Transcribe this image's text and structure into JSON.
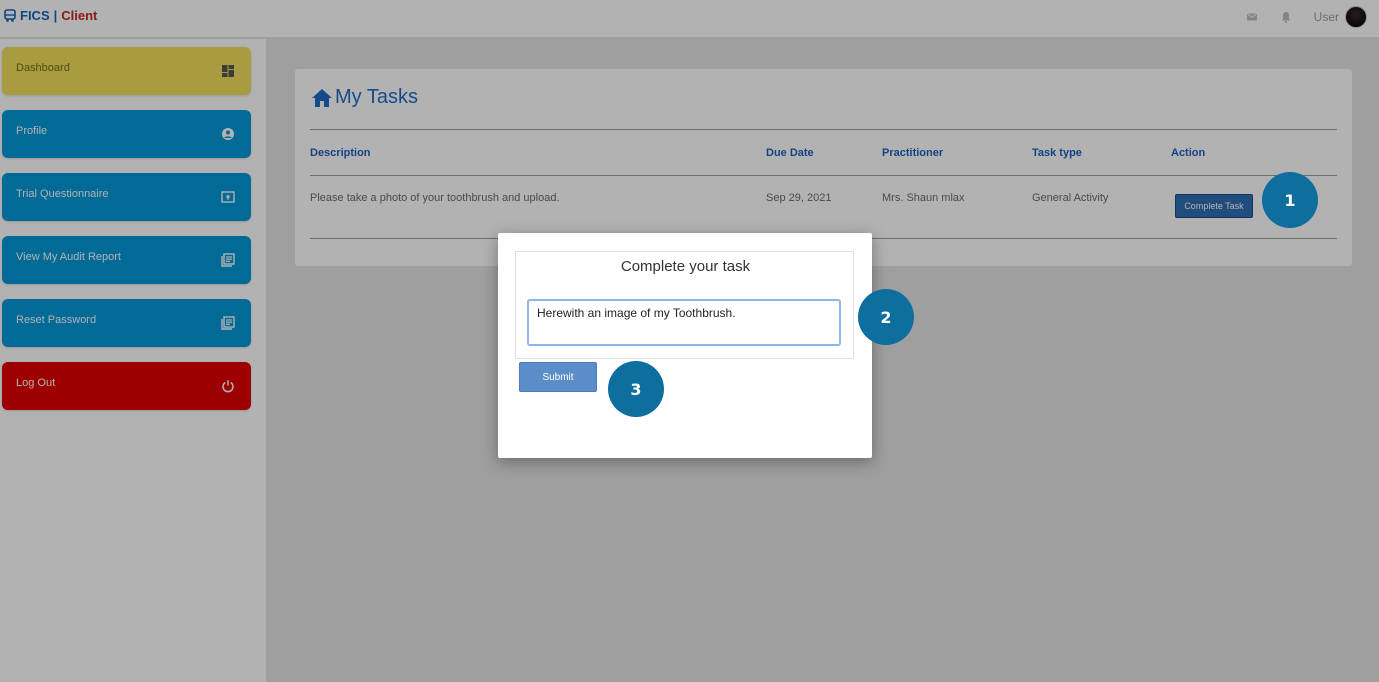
{
  "header": {
    "brand_primary": "FICS",
    "brand_separator": "|",
    "brand_secondary": "Client",
    "user_label": "User",
    "icons": [
      "bus-icon",
      "mail-icon",
      "bell-icon",
      "avatar"
    ]
  },
  "sidebar": {
    "items": [
      {
        "label": "Dashboard",
        "icon": "dashboard-icon",
        "color": "#f1df5c"
      },
      {
        "label": "Profile",
        "icon": "user-circle-icon",
        "color": "#0299d8"
      },
      {
        "label": "Trial Questionnaire",
        "icon": "upload-icon",
        "color": "#0299d8"
      },
      {
        "label": "View My Audit Report",
        "icon": "report-icon",
        "color": "#0299d8"
      },
      {
        "label": "Reset Password",
        "icon": "report-icon",
        "color": "#0299d8"
      },
      {
        "label": "Log Out",
        "icon": "power-icon",
        "color": "#e00000"
      }
    ]
  },
  "main": {
    "title": "My Tasks",
    "columns": [
      "Description",
      "Due Date",
      "Practitioner",
      "Task type",
      "Action"
    ],
    "rows": [
      {
        "description": "Please take a photo of your toothbrush and upload.",
        "due_date": "Sep 29, 2021",
        "practitioner": "Mrs. Shaun mlax",
        "task_type": "General Activity",
        "action_label": "Complete Task"
      }
    ]
  },
  "modal": {
    "title": "Complete your task",
    "text_value": "Herewith an image of my Toothbrush.",
    "submit_label": "Submit"
  },
  "steps": [
    "1",
    "2",
    "3"
  ],
  "colors": {
    "accent_blue": "#1e6ec8",
    "step_marker": "#0e6e9e",
    "sidebar_blue": "#0299d8",
    "sidebar_yellow": "#f1df5c",
    "sidebar_red": "#e00000"
  }
}
